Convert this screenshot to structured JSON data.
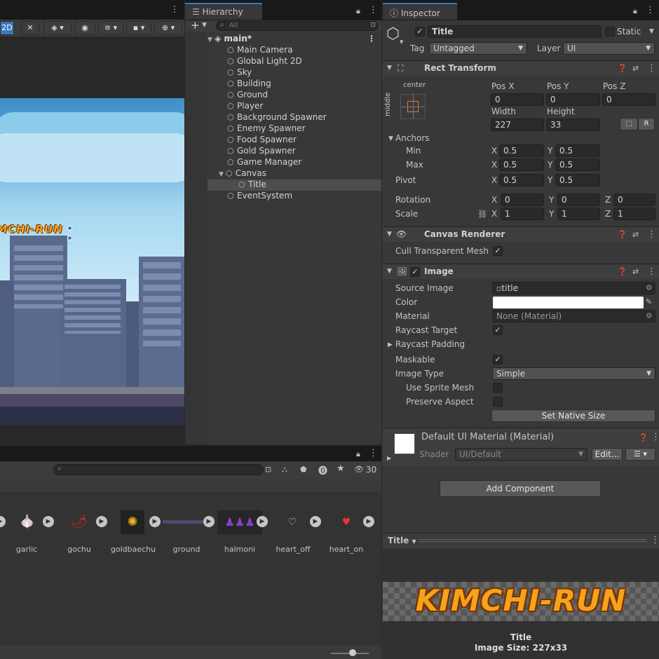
{
  "scene_toolbar": {
    "mode_2d": "2D"
  },
  "hierarchy": {
    "tab": "Hierarchy",
    "search_placeholder": "All",
    "add_label": "+",
    "root": "main*",
    "items": [
      "Main Camera",
      "Global Light 2D",
      "Sky",
      "Building",
      "Ground",
      "Player",
      "Background Spawner",
      "Enemy Spawner",
      "Food Spawner",
      "Gold Spawner",
      "Game Manager",
      "Canvas",
      "Title",
      "EventSystem"
    ]
  },
  "inspector": {
    "tab": "Inspector",
    "object_name": "Title",
    "static_label": "Static",
    "tag_label": "Tag",
    "tag_value": "Untagged",
    "layer_label": "Layer",
    "layer_value": "UI",
    "rect_transform": {
      "title": "Rect Transform",
      "anchor_h": "center",
      "anchor_v": "middle",
      "posx_label": "Pos X",
      "posx": "0",
      "posy_label": "Pos Y",
      "posy": "0",
      "posz_label": "Pos Z",
      "posz": "0",
      "width_label": "Width",
      "width": "227",
      "height_label": "Height",
      "height": "33",
      "r_btn": "R",
      "anchors_label": "Anchors",
      "min_label": "Min",
      "min_x": "0.5",
      "min_y": "0.5",
      "max_label": "Max",
      "max_x": "0.5",
      "max_y": "0.5",
      "pivot_label": "Pivot",
      "pivot_x": "0.5",
      "pivot_y": "0.5",
      "rotation_label": "Rotation",
      "rot_x": "0",
      "rot_y": "0",
      "rot_z": "0",
      "scale_label": "Scale",
      "scale_x": "1",
      "scale_y": "1",
      "scale_z": "1",
      "x": "X",
      "y": "Y",
      "z": "Z"
    },
    "canvas_renderer": {
      "title": "Canvas Renderer",
      "cull_label": "Cull Transparent Mesh"
    },
    "image": {
      "title": "Image",
      "source_label": "Source Image",
      "source_value": "title",
      "color_label": "Color",
      "color_value": "#ffffff",
      "material_label": "Material",
      "material_value": "None (Material)",
      "raycast_target_label": "Raycast Target",
      "raycast_padding_label": "Raycast Padding",
      "maskable_label": "Maskable",
      "image_type_label": "Image Type",
      "image_type_value": "Simple",
      "use_sprite_mesh_label": "Use Sprite Mesh",
      "preserve_aspect_label": "Preserve Aspect",
      "native_size_btn": "Set Native Size"
    },
    "material": {
      "title": "Default UI Material (Material)",
      "shader_label": "Shader",
      "shader_value": "UI/Default",
      "edit_btn": "Edit..."
    },
    "add_component": "Add Component",
    "preview": {
      "dropdown": "Title",
      "game_title": "KIMCHI-RUN",
      "caption_name": "Title",
      "caption_size": "Image Size: 227x33"
    }
  },
  "scene": {
    "logo_text": "KIMCHI-RUN"
  },
  "project": {
    "count": "30",
    "assets": [
      "garlic",
      "gochu",
      "goldbaechu",
      "ground",
      "halmoni",
      "heart_off",
      "heart_on"
    ]
  },
  "colors": {
    "accent": "#3a79bb",
    "sky": "#7ec3e8",
    "panel": "#383838"
  }
}
